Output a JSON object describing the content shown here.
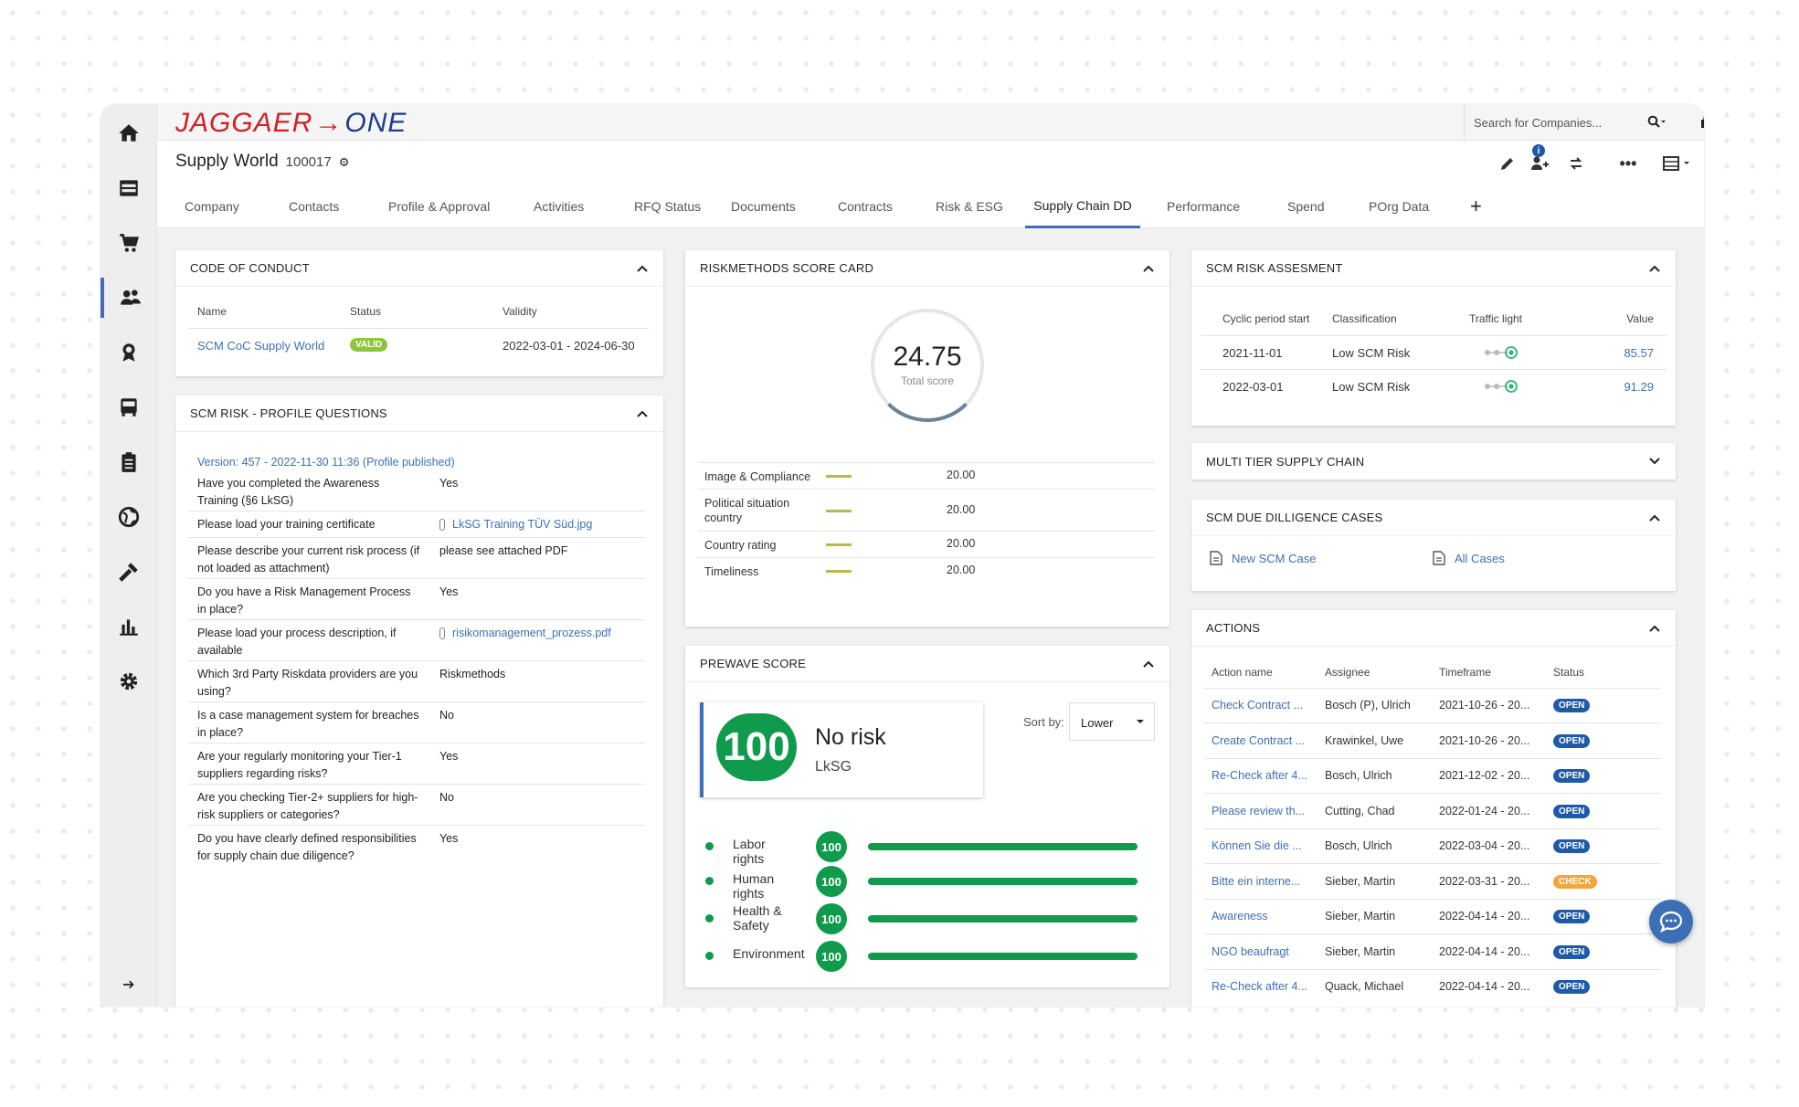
{
  "logo": {
    "part1": "JAGGAER",
    "arrow": "→",
    "part2": "ONE"
  },
  "search": {
    "placeholder": "Search for Companies..."
  },
  "header": {
    "title": "Supply World",
    "number": "100017",
    "info_badge": "i"
  },
  "tabs": [
    "Company",
    "Contacts",
    "Profile & Approval",
    "Activities",
    "RFQ Status",
    "Documents",
    "Contracts",
    "Risk & ESG",
    "Supply Chain DD",
    "Performance",
    "Spend",
    "POrg Data"
  ],
  "active_tab": "Supply Chain DD",
  "add_tab": "+",
  "coc": {
    "title": "CODE OF CONDUCT",
    "headers": {
      "name": "Name",
      "status": "Status",
      "validity": "Validity"
    },
    "row": {
      "name": "SCM CoC Supply World",
      "status": "VALID",
      "validity": "2022-03-01 - 2024-06-30"
    }
  },
  "profile_questions": {
    "title": "SCM RISK - PROFILE QUESTIONS",
    "version": "Version: 457 - 2022-11-30 11:36 (Profile published)",
    "items": [
      {
        "q": "Have you completed the Awareness Training (§6 LkSG)",
        "a": "Yes",
        "file": false
      },
      {
        "q": "Please load your training certificate",
        "a": "LkSG Training TÜV Süd.jpg",
        "file": true
      },
      {
        "q": "Please describe your current risk process (if not loaded as attachment)",
        "a": "please see attached PDF",
        "file": false
      },
      {
        "q": "Do you have a Risk Management Process in place?",
        "a": "Yes",
        "file": false
      },
      {
        "q": "Please load your process description, if available",
        "a": "risikomanagement_prozess.pdf",
        "file": true
      },
      {
        "q": "Which 3rd Party Riskdata providers are you using?",
        "a": "Riskmethods",
        "file": false
      },
      {
        "q": "Is a case management system for breaches in place?",
        "a": "No",
        "file": false
      },
      {
        "q": "Are your regularly monitoring your Tier-1 suppliers regarding risks?",
        "a": "Yes",
        "file": false
      },
      {
        "q": "Are you checking Tier-2+ suppliers for high-risk suppliers or categories?",
        "a": "No",
        "file": false
      },
      {
        "q": "Do you have clearly defined responsibilities for supply chain due diligence?",
        "a": "Yes",
        "file": false
      }
    ]
  },
  "scorecard": {
    "title": "RISKMETHODS SCORE CARD",
    "total": "24.75",
    "total_label": "Total score",
    "gauge_fraction": 0.25,
    "rows": [
      {
        "label": "Image & Compliance",
        "value": "20.00"
      },
      {
        "label": "Political situation country",
        "value": "20.00"
      },
      {
        "label": "Country rating",
        "value": "20.00"
      },
      {
        "label": "Timeliness",
        "value": "20.00"
      }
    ]
  },
  "prewave": {
    "title": "PREWAVE SCORE",
    "score": "100",
    "risk_label": "No risk",
    "sub_label": "LkSG",
    "sort_label": "Sort by:",
    "sort_value": "Lower",
    "items": [
      {
        "label": "Labor rights",
        "score": "100",
        "fraction": 1.0
      },
      {
        "label": "Human rights",
        "score": "100",
        "fraction": 1.0
      },
      {
        "label": "Health & Safety",
        "score": "100",
        "fraction": 1.0
      },
      {
        "label": "Environment",
        "score": "100",
        "fraction": 1.0
      }
    ]
  },
  "risk_assessment": {
    "title": "SCM RISK ASSESMENT",
    "headers": {
      "period": "Cyclic period start",
      "class": "Classification",
      "traffic": "Traffic light",
      "value": "Value"
    },
    "rows": [
      {
        "period": "2021-11-01",
        "class": "Low SCM Risk",
        "value": "85.57"
      },
      {
        "period": "2022-03-01",
        "class": "Low SCM Risk",
        "value": "91.29"
      }
    ]
  },
  "multi_tier": {
    "title": "MULTI TIER SUPPLY CHAIN"
  },
  "dd_cases": {
    "title": "SCM DUE DILLIGENCE CASES",
    "new_case": "New SCM Case",
    "all_cases": "All Cases"
  },
  "actions": {
    "title": "ACTIONS",
    "headers": {
      "name": "Action name",
      "assignee": "Assignee",
      "timeframe": "Timeframe",
      "status": "Status"
    },
    "rows": [
      {
        "name": "Check Contract ...",
        "assignee": "Bosch (P), Ulrich",
        "timeframe": "2021-10-26 - 20...",
        "status": "OPEN"
      },
      {
        "name": "Create Contract ...",
        "assignee": "Krawinkel, Uwe",
        "timeframe": "2021-10-26 - 20...",
        "status": "OPEN"
      },
      {
        "name": "Re-Check after 4...",
        "assignee": "Bosch, Ulrich",
        "timeframe": "2021-12-02 - 20...",
        "status": "OPEN"
      },
      {
        "name": "Please review th...",
        "assignee": "Cutting, Chad",
        "timeframe": "2022-01-24 - 20...",
        "status": "OPEN"
      },
      {
        "name": "Können Sie die ...",
        "assignee": "Bosch, Ulrich",
        "timeframe": "2022-03-04 - 20...",
        "status": "OPEN"
      },
      {
        "name": "Bitte ein interne...",
        "assignee": "Sieber, Martin",
        "timeframe": "2022-03-31 - 20...",
        "status": "CHECK"
      },
      {
        "name": "Awareness",
        "assignee": "Sieber, Martin",
        "timeframe": "2022-04-14 - 20...",
        "status": "OPEN"
      },
      {
        "name": "NGO beaufragt",
        "assignee": "Sieber, Martin",
        "timeframe": "2022-04-14 - 20...",
        "status": "OPEN"
      },
      {
        "name": "Re-Check after 4...",
        "assignee": "Quack, Michael",
        "timeframe": "2022-04-14 - 20...",
        "status": "OPEN"
      }
    ]
  },
  "colors": {
    "accent": "#3d6fb6",
    "green": "#0f9a4c",
    "open": "#1e5aa8",
    "check": "#f2a63b",
    "valid": "#8cc63f"
  }
}
